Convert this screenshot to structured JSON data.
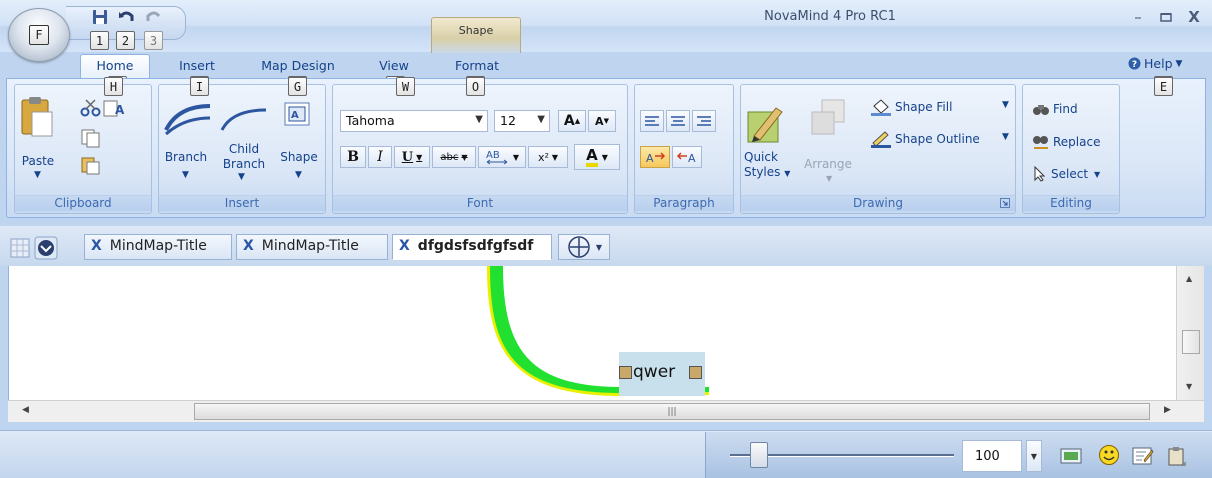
{
  "app": {
    "title": "NovaMind 4 Pro RC1"
  },
  "qat": {
    "orb_key": "F",
    "keytips": [
      "1",
      "2",
      "3"
    ]
  },
  "context_tab": {
    "label": "Shape"
  },
  "tabs": [
    {
      "label": "Home",
      "keytip": "H",
      "active": true
    },
    {
      "label": "Insert",
      "keytip": "I"
    },
    {
      "label": "Map Design",
      "keytip": "G"
    },
    {
      "label": "View",
      "keytip": "W"
    },
    {
      "label": "Format",
      "keytip": "O"
    }
  ],
  "help": {
    "label": "Help",
    "keytip": "E"
  },
  "ribbon": {
    "clipboard": {
      "label": "Clipboard",
      "paste": "Paste"
    },
    "insert": {
      "label": "Insert",
      "branch": "Branch",
      "child_branch_1": "Child",
      "child_branch_2": "Branch",
      "shape": "Shape"
    },
    "font": {
      "label": "Font",
      "family": "Tahoma",
      "size": "12",
      "bold": "B",
      "italic": "I",
      "underline": "U",
      "strike": "abc",
      "superscript": "x²",
      "font_color": "A"
    },
    "paragraph": {
      "label": "Paragraph"
    },
    "drawing": {
      "label": "Drawing",
      "quick_styles_1": "Quick",
      "quick_styles_2": "Styles",
      "arrange": "Arrange",
      "shape_fill": "Shape Fill",
      "shape_outline": "Shape Outline"
    },
    "editing": {
      "label": "Editing",
      "find": "Find",
      "replace": "Replace",
      "select": "Select"
    }
  },
  "doc_tabs": [
    {
      "label": "MindMap-Title",
      "icon": "X"
    },
    {
      "label": "MindMap-Title",
      "icon": "X"
    },
    {
      "label": "dfgdsfsdfgfsdf",
      "icon": "X",
      "active": true
    }
  ],
  "canvas": {
    "node_text": "qwer"
  },
  "status": {
    "zoom": "100"
  },
  "colors": {
    "branch": "#22e030",
    "branch_outline": "#e8f000",
    "node_bg": "#c8e0ec"
  }
}
